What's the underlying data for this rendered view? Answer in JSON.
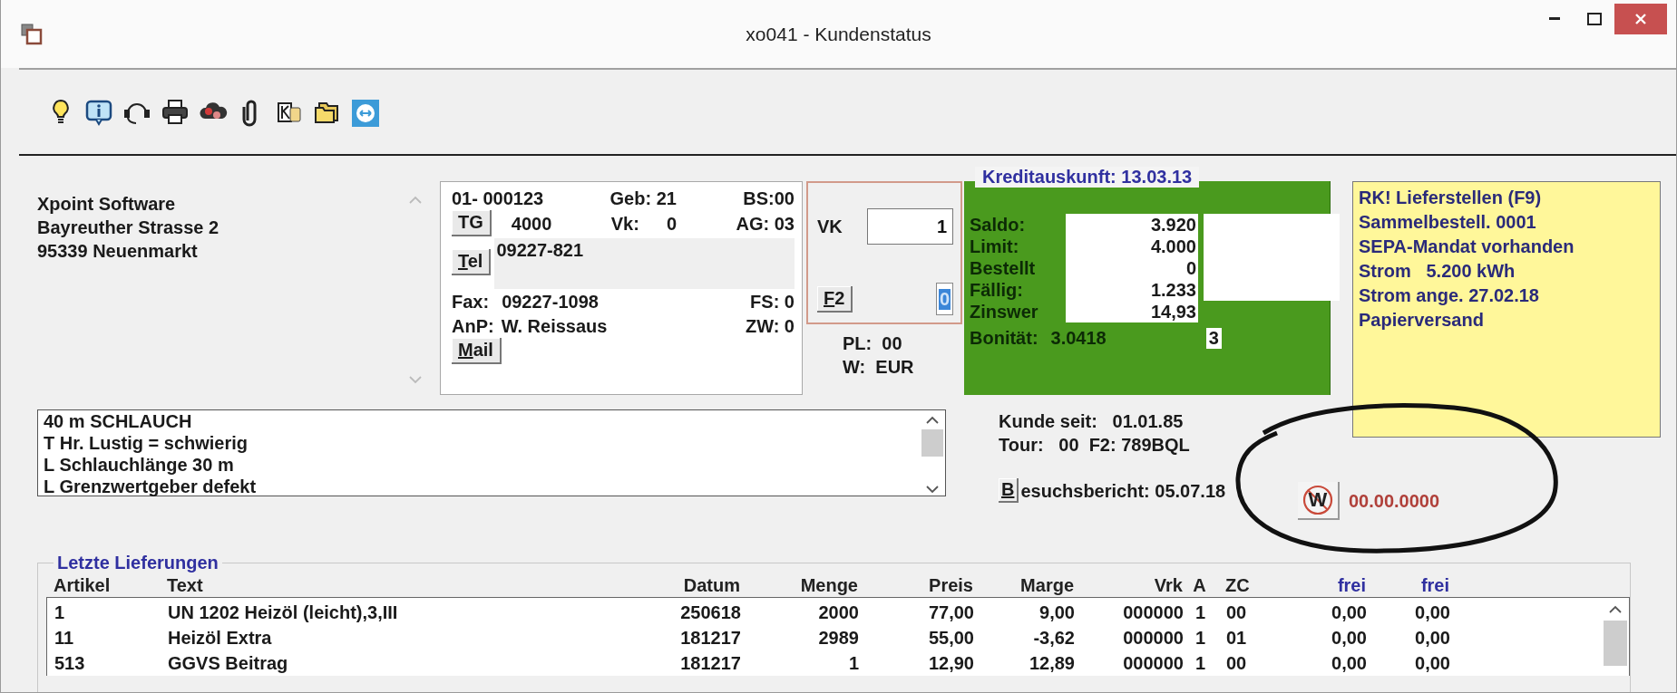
{
  "window": {
    "title": "xo041 - Kundenstatus"
  },
  "address": [
    "Xpoint Software",
    "Bayreuther Strasse 2",
    "95339 Neuenmarkt"
  ],
  "customer": {
    "number": "01- 000123",
    "birth": "Geb: 21",
    "bs": "BS:00",
    "tg_button": {
      "label": "TG",
      "mnemonic": false
    },
    "tg": "4000",
    "vk_label": "Vk:",
    "vk": "0",
    "ag": "AG: 03",
    "tel_button": {
      "label": "Tel",
      "mnemonic": true
    },
    "phone": "09227-821",
    "fax_label": "Fax:",
    "fax": "09227-1098",
    "fs": "FS: 0",
    "anp_label": "AnP:",
    "anp": "W. Reissaus",
    "zw": "ZW: 0",
    "mail_button": {
      "label": "Mail",
      "mnemonic": true
    }
  },
  "sales": {
    "vk_label": "VK",
    "vk_value": "1",
    "f2_button": {
      "label": "F2",
      "mnemonic": true
    },
    "f2_value": {
      "value": "0",
      "selected": true
    },
    "pl": "PL:  00",
    "w": "W:  EUR"
  },
  "credit": {
    "title": "Kreditauskunft: 13.03.13",
    "rows": [
      {
        "label": "Saldo:",
        "value": "3.920"
      },
      {
        "label": "Limit:",
        "value": "4.000"
      },
      {
        "label": "Bestellt",
        "value": "0"
      },
      {
        "label": "Fällig:",
        "value": "1.233"
      },
      {
        "label": "Zinswer",
        "value": "14,93"
      }
    ],
    "rating_label": "Bonität:",
    "rating_value": "3.0418",
    "rating_class": "3"
  },
  "notes": [
    "RK! Lieferstellen (F9)",
    "Sammelbestell. 0001",
    "SEPA-Mandat vorhanden",
    "Strom   5.200 kWh",
    "Strom ange. 27.02.18",
    "Papierversand"
  ],
  "memo": [
    "40 m SCHLAUCH",
    "T Hr. Lustig = schwierig",
    "L Schlauchlänge 30 m",
    "L Grenzwertgeber defekt"
  ],
  "since": "Kunde seit:   01.01.85",
  "tour": "Tour:   00  F2: 789BQL",
  "report": {
    "button": {
      "label": "B",
      "mnemonic": true
    },
    "text": "esuchsbericht: 05.07.18"
  },
  "w_button": {
    "label": "W"
  },
  "w_date": "00.00.0000",
  "deliveries": {
    "title": "Letzte Lieferungen",
    "columns": [
      {
        "label": "Artikel",
        "accent": false
      },
      {
        "label": "Text",
        "accent": false
      },
      {
        "label": "Datum",
        "accent": false
      },
      {
        "label": "Menge",
        "accent": false
      },
      {
        "label": "Preis",
        "accent": false
      },
      {
        "label": "Marge",
        "accent": false
      },
      {
        "label": "Vrk",
        "accent": false
      },
      {
        "label": "A",
        "accent": false
      },
      {
        "label": "ZC",
        "accent": false
      },
      {
        "label": "frei",
        "accent": true
      },
      {
        "label": "frei",
        "accent": true
      }
    ],
    "rows": [
      [
        "1",
        "UN 1202 Heizöl (leicht),3,III",
        "250618",
        "2000",
        "77,00",
        "9,00",
        "000000",
        "1",
        "00",
        "0,00",
        "0,00"
      ],
      [
        "11",
        "Heizöl Extra",
        "181217",
        "2989",
        "55,00",
        "-3,62",
        "000000",
        "1",
        "01",
        "0,00",
        "0,00"
      ],
      [
        "513",
        "GGVS Beitrag",
        "181217",
        "1",
        "12,90",
        "12,89",
        "000000",
        "1",
        "00",
        "0,00",
        "0,00"
      ]
    ]
  }
}
